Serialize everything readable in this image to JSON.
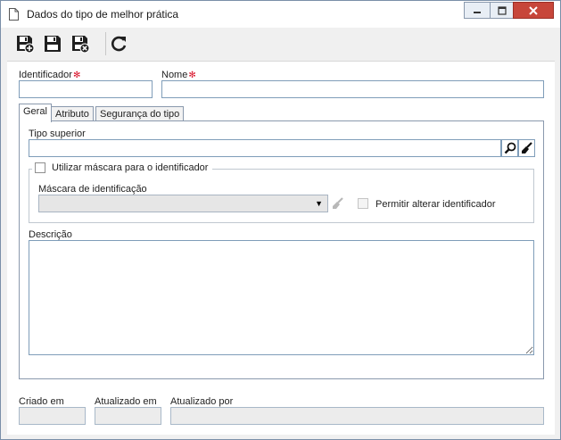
{
  "window": {
    "title": "Dados do tipo de melhor prática"
  },
  "toolbar": {
    "buttons": [
      {
        "name": "save-new-button",
        "icon": "save-new-icon"
      },
      {
        "name": "save-button",
        "icon": "save-icon"
      },
      {
        "name": "save-close-button",
        "icon": "save-close-icon"
      },
      {
        "name": "refresh-button",
        "icon": "refresh-icon"
      }
    ]
  },
  "form": {
    "identificador_label": "Identificador",
    "identificador_value": "",
    "nome_label": "Nome",
    "nome_value": "",
    "required_marker": "✻"
  },
  "tabs": [
    {
      "label": "Geral",
      "active": true
    },
    {
      "label": "Atributo",
      "active": false
    },
    {
      "label": "Segurança do tipo",
      "active": false
    }
  ],
  "geral": {
    "tipo_superior_label": "Tipo superior",
    "tipo_superior_value": "",
    "usar_mascara_label": "Utilizar máscara para o identificador",
    "usar_mascara_checked": false,
    "mascara_label": "Máscara de identificação",
    "mascara_value": "",
    "permitir_alterar_label": "Permitir alterar identificador",
    "permitir_alterar_checked": false,
    "descricao_label": "Descrição",
    "descricao_value": ""
  },
  "footer": {
    "criado_em_label": "Criado em",
    "criado_em_value": "",
    "atualizado_em_label": "Atualizado em",
    "atualizado_em_value": "",
    "atualizado_por_label": "Atualizado por",
    "atualizado_por_value": ""
  },
  "colors": {
    "required": "#d9142b",
    "close_button": "#c7463a",
    "border": "#7f9db9"
  }
}
